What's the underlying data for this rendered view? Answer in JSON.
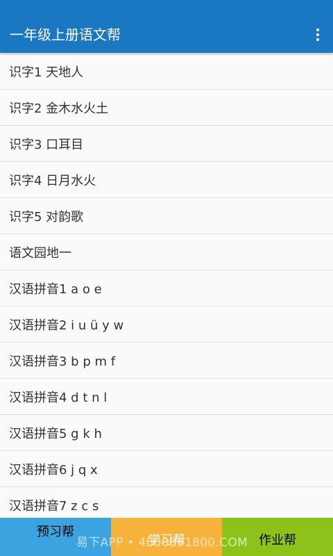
{
  "app": {
    "title": "一年级上册语文帮",
    "menu_icon": "more-vert-icon",
    "header_color": "#1a78c2"
  },
  "lessons": [
    "识字1 天地人",
    "识字2 金木水火土",
    "识字3 口耳目",
    "识字4 日月水火",
    "识字5 对韵歌",
    "语文园地一",
    "汉语拼音1 a o e",
    "汉语拼音2 i u ü y w",
    "汉语拼音3 b p m f",
    "汉语拼音4 d t n l",
    "汉语拼音5 g k h",
    "汉语拼音6 j q x",
    "汉语拼音7 z c s"
  ],
  "tabs": [
    {
      "label": "预习帮",
      "color": "#3aa3e0"
    },
    {
      "label": "学习帮",
      "color": "#f7b23b"
    },
    {
      "label": "作业帮",
      "color": "#8cc31a"
    }
  ],
  "watermark": "易下APP • 4000891800.COM"
}
